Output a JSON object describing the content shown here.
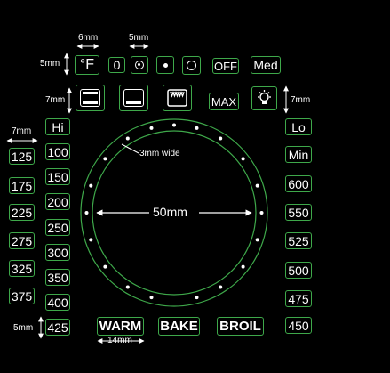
{
  "dimensions": {
    "w6": "6mm",
    "w5": "5mm",
    "h5": "5mm",
    "h7_left": "7mm",
    "h7_right": "7mm",
    "w7": "7mm",
    "ring_width": "3mm wide",
    "diameter": "50mm",
    "h5_bottom": "5mm",
    "w14": "14mm"
  },
  "top_row": {
    "fahrenheit": "°F",
    "zero": "0",
    "off": "OFF",
    "med": "Med"
  },
  "icon_row": {
    "max": "MAX"
  },
  "left_column": [
    "Hi",
    "100",
    "150",
    "200",
    "250",
    "300",
    "350",
    "400",
    "425"
  ],
  "left_outer_column": [
    "125",
    "175",
    "225",
    "275",
    "325",
    "375"
  ],
  "right_column": [
    "Lo",
    "Min",
    "600",
    "550",
    "525",
    "500",
    "475",
    "450"
  ],
  "bottom_row": {
    "warm": "WARM",
    "bake": "BAKE",
    "broil": "BROIL"
  },
  "colors": {
    "outline": "#3ea84a",
    "background": "#000000",
    "text": "#ffffff"
  },
  "icons": [
    "bar-top-bottom-icon",
    "bar-bottom-icon",
    "broil-element-icon",
    "light-bulb-icon",
    "dot-in-circle-icon",
    "small-dot-icon",
    "empty-circle-icon"
  ]
}
